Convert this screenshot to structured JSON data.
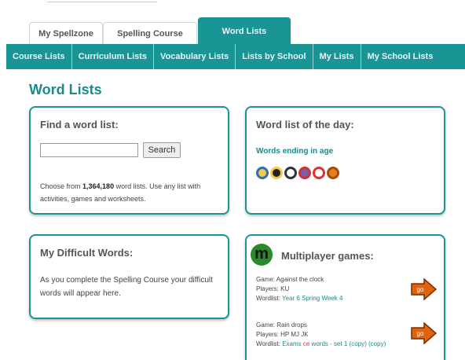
{
  "tabs": [
    {
      "label": "My Spellzone"
    },
    {
      "label": "Spelling Course"
    },
    {
      "label": "Word Lists"
    }
  ],
  "subnav": [
    {
      "label": "Course Lists"
    },
    {
      "label": "Curriculum Lists"
    },
    {
      "label": "Vocabulary Lists"
    },
    {
      "label": "Lists by School"
    },
    {
      "label": "My Lists"
    },
    {
      "label": "My School Lists"
    }
  ],
  "page_title": "Word Lists",
  "find": {
    "title": "Find a word list:",
    "search_value": "",
    "search_button": "Search",
    "desc_prefix": "Choose from ",
    "count": "1,364,180",
    "desc_suffix": " word lists. Use any list with activities, games and worksheets."
  },
  "day": {
    "title": "Word list of the day:",
    "link": "Words ending in age"
  },
  "difficult": {
    "title": "My Difficult Words:",
    "desc": "As you complete the Spelling Course your difficult words will appear here."
  },
  "multi": {
    "logo": "m",
    "title": "Multiplayer games:",
    "games": [
      {
        "game": "Game: Against the clock",
        "players": "Players: KU",
        "wordlist_label": "Wordlist: ",
        "wordlist": "Year 6 Spring Week 4",
        "go": "go"
      },
      {
        "game": "Game: Rain drops",
        "players": "Players: HP MJ JK",
        "wordlist_label": "Wordlist: ",
        "wordlist_a": "Exams ",
        "wordlist_hot": "ce",
        "wordlist_b": " words - set 1 (copy) (copy)",
        "go": "go"
      }
    ]
  },
  "colors": {
    "teal": "#1a9595",
    "title_teal": "#1a8a8a",
    "go_orange": "#e0620c"
  }
}
